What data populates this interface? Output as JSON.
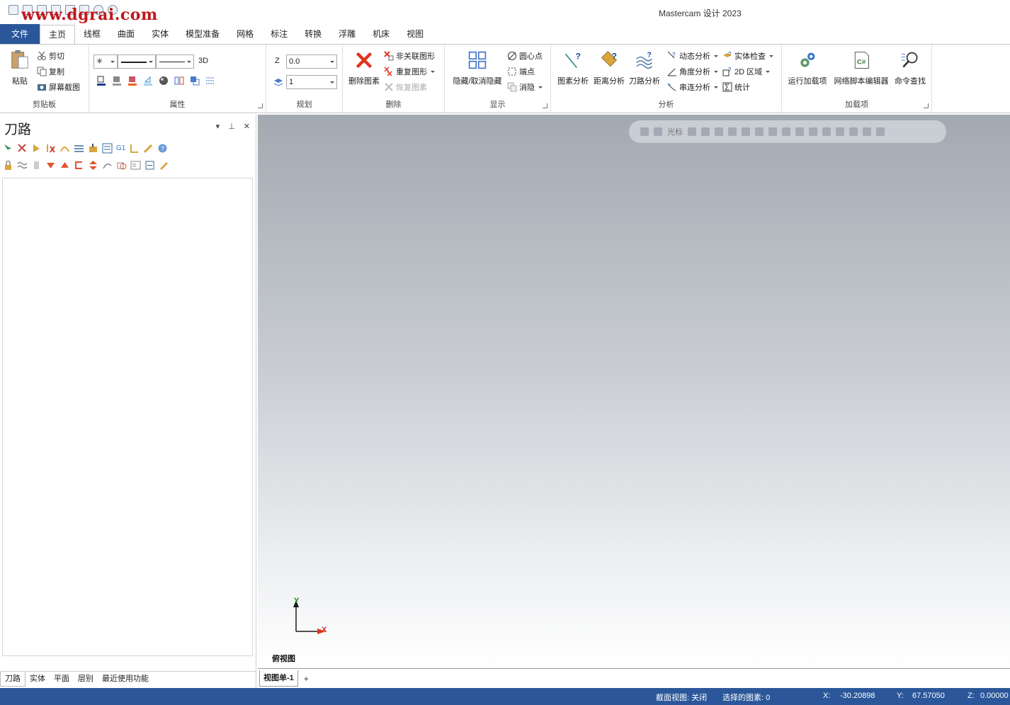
{
  "watermark": "www.dgrai.com",
  "app_title": "Mastercam 设计 2023",
  "tabs": [
    "文件",
    "主页",
    "线框",
    "曲面",
    "实体",
    "模型准备",
    "网格",
    "标注",
    "转换",
    "浮雕",
    "机床",
    "视图"
  ],
  "ribbon": {
    "clipboard": {
      "label": "剪贴板",
      "paste": "粘贴",
      "cut": "剪切",
      "copy": "复制",
      "screenshot": "屏幕截图"
    },
    "attributes": {
      "label": "属性",
      "mode_3d": "3D"
    },
    "plan": {
      "label": "规划",
      "z_label": "Z",
      "z_value": "0.0",
      "level_value": "1"
    },
    "delete": {
      "label": "删除",
      "delete_entities": "删除图素",
      "non_assoc": "非关联图形",
      "duplicate": "重复图形",
      "undelete": "恢复图素"
    },
    "display": {
      "label": "显示",
      "hide_unhide": "隐藏/取消隐藏",
      "arc_center": "圆心点",
      "endpoints": "端点",
      "blank": "消隐"
    },
    "analyze": {
      "label": "分析",
      "entity": "图素分析",
      "distance": "距离分析",
      "toolpath": "刀路分析",
      "dynamic": "动态分析",
      "angle": "角度分析",
      "chain": "串连分析",
      "solid_check": "实体检查",
      "area_2d": "2D 区域",
      "statistics": "统计"
    },
    "addins": {
      "label": "加载项",
      "run": "运行加载项",
      "net_script": "网络脚本编辑器",
      "finder": "命令查找"
    }
  },
  "panel": {
    "title": "刀路",
    "tabs": [
      "刀路",
      "实体",
      "平面",
      "层别",
      "最近使用功能"
    ]
  },
  "viewport": {
    "floatbar_label": "光标",
    "axis_y": "Y",
    "axis_x": "X",
    "view_name": "俯视图"
  },
  "view_tabs": {
    "active": "视图单-1",
    "add": "+"
  },
  "status": {
    "section_view": "截面视图: 关闭",
    "selected": "选择的图素: 0",
    "x_label": "X:",
    "x_value": "-30.20898",
    "y_label": "Y:",
    "y_value": "67.57050",
    "z_label": "Z:",
    "z_value": "0.00000"
  }
}
